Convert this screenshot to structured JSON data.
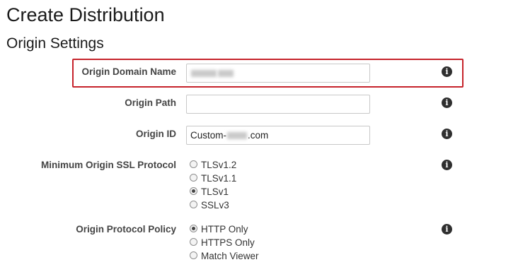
{
  "page": {
    "title": "Create Distribution"
  },
  "section": {
    "title": "Origin Settings"
  },
  "fields": {
    "origin_domain_name": {
      "label": "Origin Domain Name",
      "value": ""
    },
    "origin_path": {
      "label": "Origin Path",
      "value": ""
    },
    "origin_id": {
      "label": "Origin ID",
      "value_prefix": "Custom-",
      "value_suffix": ".com"
    },
    "min_ssl_protocol": {
      "label": "Minimum Origin SSL Protocol",
      "options": [
        "TLSv1.2",
        "TLSv1.1",
        "TLSv1",
        "SSLv3"
      ],
      "selected": "TLSv1"
    },
    "origin_protocol_policy": {
      "label": "Origin Protocol Policy",
      "options": [
        "HTTP Only",
        "HTTPS Only",
        "Match Viewer"
      ],
      "selected": "HTTP Only"
    }
  },
  "info_icon": {
    "glyph": "i",
    "icon": "info-icon"
  },
  "colors": {
    "highlight_border": "#c6232b",
    "icon_fill": "#2f2f2f"
  }
}
